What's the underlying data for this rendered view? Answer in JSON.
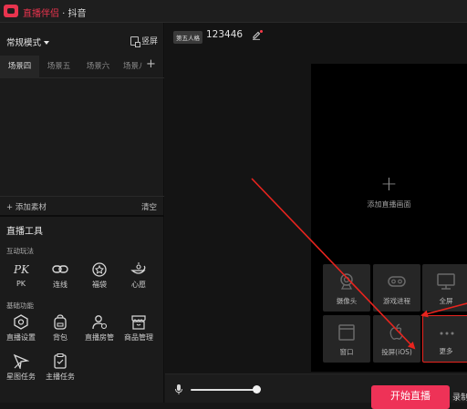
{
  "app": {
    "brand": "直播伴侣",
    "separator": " · ",
    "platform": "抖音"
  },
  "left_panel": {
    "mode_label": "常规模式",
    "vertical_label": "竖屏",
    "scene_tabs": [
      "场景四",
      "场景五",
      "场景六",
      "场景八"
    ],
    "add_material": "+ 添加素材",
    "clear": "清空"
  },
  "tools": {
    "title": "直播工具",
    "groups": [
      {
        "label": "互动玩法",
        "items": [
          {
            "label": "PK",
            "icon": "pk-icon"
          },
          {
            "label": "连线",
            "icon": "link-icon"
          },
          {
            "label": "福袋",
            "icon": "lucky-bag-icon"
          },
          {
            "label": "心愿",
            "icon": "wish-lamp-icon"
          }
        ]
      },
      {
        "label": "基础功能",
        "items": [
          {
            "label": "直播设置",
            "icon": "hexagon-settings-icon"
          },
          {
            "label": "背包",
            "icon": "backpack-icon"
          },
          {
            "label": "直播房管",
            "icon": "room-admin-icon"
          },
          {
            "label": "商品管理",
            "icon": "shop-icon"
          },
          {
            "label": "星图任务",
            "icon": "star-map-icon"
          },
          {
            "label": "主播任务",
            "icon": "task-clipboard-icon"
          }
        ]
      }
    ]
  },
  "main": {
    "room_tag": "第五人格",
    "room_id": "123446",
    "add_scene": "添加直播画面",
    "sources": [
      {
        "label": "摄像头",
        "icon": "camera-icon"
      },
      {
        "label": "游戏进程",
        "icon": "gamepad-icon"
      },
      {
        "label": "全屏",
        "icon": "monitor-icon"
      },
      {
        "label": "窗口",
        "icon": "window-icon"
      },
      {
        "label": "投屏(iOS)",
        "icon": "apple-icon"
      },
      {
        "label": "更多",
        "icon": "more-dots-icon"
      }
    ],
    "start_button": "开始直播",
    "record_button": "录制"
  },
  "colors": {
    "accent": "#ee3257",
    "highlight": "#e8241e",
    "background": "#161616"
  }
}
